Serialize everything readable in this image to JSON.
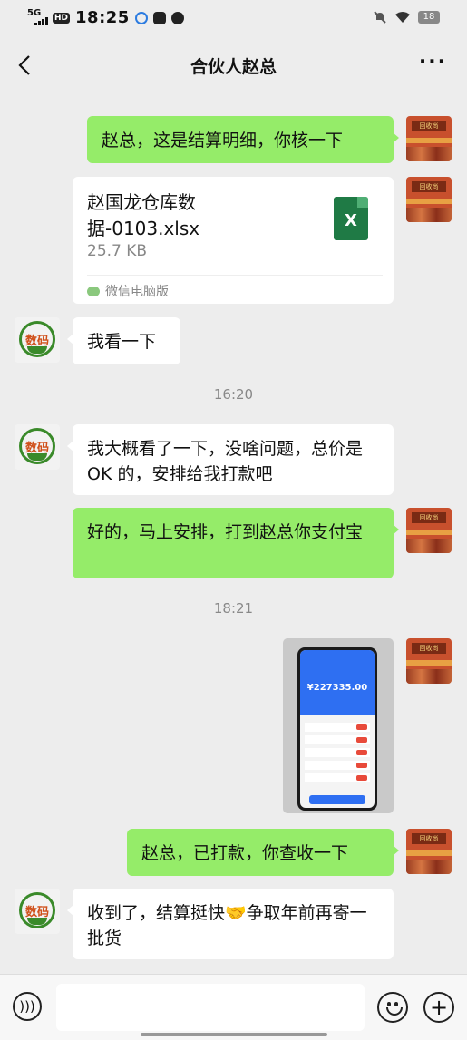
{
  "status_bar": {
    "network": "5G",
    "hd": "HD",
    "time": "18:25",
    "battery": "18",
    "icons": [
      "signal-icon",
      "cloud-icon",
      "mail-icon",
      "chat-icon",
      "mute-icon",
      "wifi-icon",
      "battery-icon"
    ]
  },
  "header": {
    "title": "合伙人赵总",
    "back_icon": "back-icon",
    "more_label": "···"
  },
  "messages": [
    {
      "from": "me",
      "type": "text",
      "text": "赵总，这是结算明细，你核一下"
    },
    {
      "from": "me",
      "type": "file",
      "file_name": "赵国龙仓库数据-0103.xlsx",
      "file_size": "25.7 KB",
      "file_icon": "X",
      "source": "微信电脑版"
    },
    {
      "from": "partner",
      "type": "text",
      "text": "我看一下"
    },
    {
      "type": "time",
      "text": "16:20"
    },
    {
      "from": "partner",
      "type": "text",
      "text": "我大概看了一下，没啥问题，总价是 OK 的，安排给我打款吧"
    },
    {
      "from": "me",
      "type": "text",
      "text": "好的，马上安排，打到赵总你支付宝"
    },
    {
      "type": "time",
      "text": "18:21"
    },
    {
      "from": "me",
      "type": "image",
      "image_text": "¥227335.00"
    },
    {
      "from": "me",
      "type": "text",
      "text": "赵总，已打款，你查收一下"
    },
    {
      "from": "partner",
      "type": "text",
      "text": "收到了，结算挺快🤝争取年前再寄一批货"
    }
  ],
  "avatars": {
    "me_sign": "回收尚",
    "partner_logo": "数码"
  },
  "colors": {
    "background": "#ededed",
    "my_bubble": "#95ec69",
    "partner_bubble": "#ffffff"
  }
}
